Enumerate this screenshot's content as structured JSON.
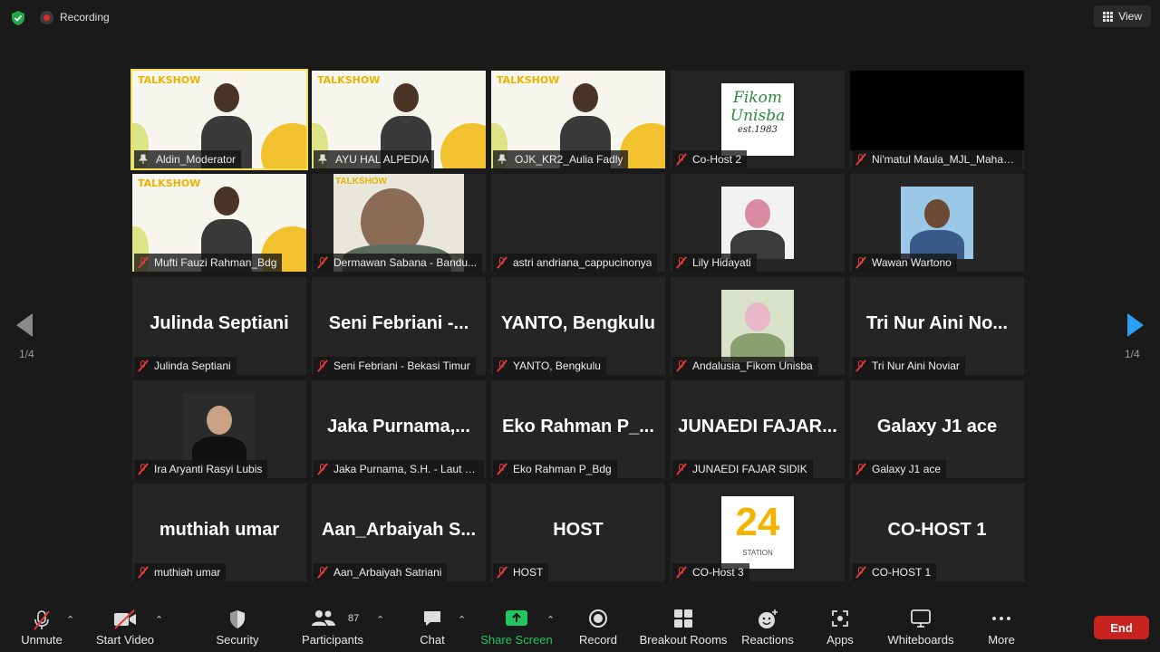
{
  "topbar": {
    "recording_label": "Recording",
    "view_label": "View"
  },
  "tiles": [
    {
      "name": "Aldin_Moderator",
      "kind": "slide",
      "pinned": true,
      "active": true
    },
    {
      "name": "AYU HAL ALPEDIA",
      "kind": "slide",
      "pinned": true
    },
    {
      "name": "OJK_KR2_Aulia Fadly",
      "kind": "slide",
      "pinned": true
    },
    {
      "name": "Co-Host 2",
      "kind": "logo-fikom"
    },
    {
      "name": "Ni'matul Maula_MJL_Mahasi...",
      "kind": "black"
    },
    {
      "name": "Mufti Fauzi Rahman_Bdg",
      "kind": "slide"
    },
    {
      "name": "Dermawan Sabana - Bandu...",
      "kind": "video"
    },
    {
      "name": "astri andriana_cappucinonya",
      "kind": "empty"
    },
    {
      "name": "Lily Hidayati",
      "kind": "photo"
    },
    {
      "name": "Wawan Wartono",
      "kind": "photo"
    },
    {
      "name": "Julinda Septiani",
      "big": "Julinda Septiani"
    },
    {
      "name": "Seni Febriani - Bekasi Timur",
      "big": "Seni Febriani -..."
    },
    {
      "name": "YANTO, Bengkulu",
      "big": "YANTO, Bengkulu"
    },
    {
      "name": "Andalusia_Fikom Unisba",
      "kind": "photo"
    },
    {
      "name": "Tri Nur Aini Noviar",
      "big": "Tri Nur Aini No..."
    },
    {
      "name": "Ira Aryanti Rasyi Lubis",
      "kind": "photo"
    },
    {
      "name": "Jaka Purnama, S.H. - Laut Bir...",
      "big": "Jaka Purnama,..."
    },
    {
      "name": "Eko Rahman P_Bdg",
      "big": "Eko Rahman P_..."
    },
    {
      "name": "JUNAEDI FAJAR SIDIK",
      "big": "JUNAEDI FAJAR..."
    },
    {
      "name": "Galaxy J1 ace",
      "big": "Galaxy J1 ace"
    },
    {
      "name": "muthiah umar",
      "big": "muthiah umar"
    },
    {
      "name": "Aan_Arbaiyah Satriani",
      "big": "Aan_Arbaiyah S..."
    },
    {
      "name": "HOST",
      "big": "HOST"
    },
    {
      "name": "CO-Host 3",
      "kind": "logo-24"
    },
    {
      "name": "CO-HOST 1",
      "big": "CO-HOST 1"
    }
  ],
  "slide_title": "TALKSHOW",
  "logo_fikom": {
    "line1": "Fikom",
    "line2": "Unisba",
    "line3": "est.1983"
  },
  "logo_24": {
    "digits": "24",
    "sub": "STATION"
  },
  "pagination": {
    "left": "1/4",
    "right": "1/4"
  },
  "toolbar": {
    "unmute": "Unmute",
    "start_video": "Start Video",
    "security": "Security",
    "participants": "Participants",
    "participants_count": "87",
    "chat": "Chat",
    "share_screen": "Share Screen",
    "record": "Record",
    "breakout_rooms": "Breakout Rooms",
    "reactions": "Reactions",
    "apps": "Apps",
    "whiteboards": "Whiteboards",
    "more": "More",
    "end": "End"
  },
  "colors": {
    "share_screen": "#22c55e",
    "end_button": "#c8241f",
    "active_speaker": "#f0e050",
    "muted": "#e03a3a"
  }
}
